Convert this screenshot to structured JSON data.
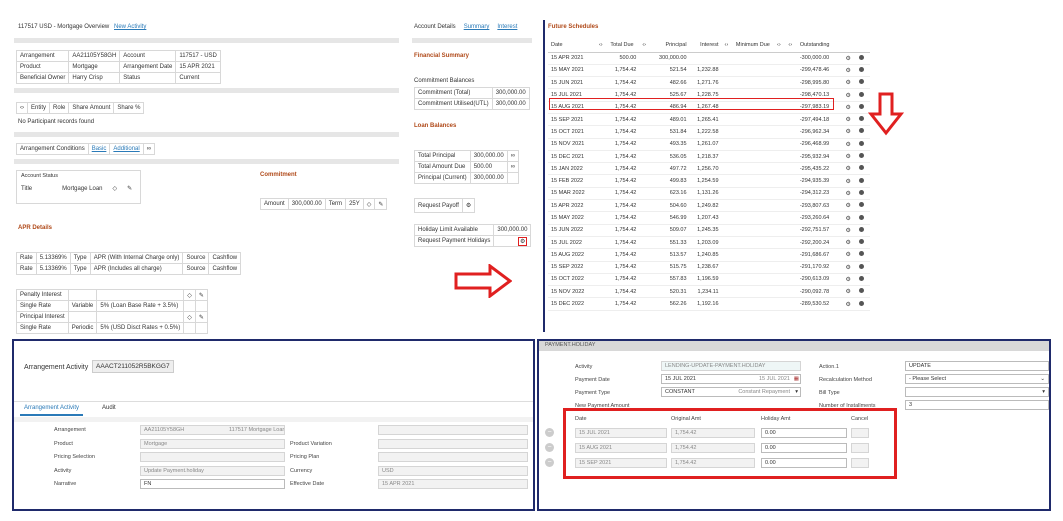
{
  "p1": {
    "title": "117517 USD - Mortgage Overview",
    "new_activity": "New Activity",
    "tabs": [
      "Account Details",
      "Summary",
      "Interest"
    ],
    "arr": [
      [
        "Arrangement",
        "AA21105Y58GH",
        "Account",
        "117517 - USD"
      ],
      [
        "Product",
        "Mortgage",
        "Arrangement Date",
        "15 APR 2021"
      ],
      [
        "Beneficial Owner",
        "Harry Crisp",
        "Status",
        "Current"
      ]
    ],
    "part_headers": [
      "Entity",
      "Role",
      "Share Amount",
      "Share %"
    ],
    "part_empty": "No Participant records found",
    "cond_label": "Arrangement Conditions",
    "cond_basic": "Basic",
    "cond_additional": "Additional",
    "acct_status": "Account Status",
    "title_lbl": "Title",
    "title_val": "Mortgage Loan",
    "commitment": "Commitment",
    "commit_row": [
      "Amount",
      "300,000.00",
      "Term",
      "25Y"
    ],
    "apr_title": "APR Details",
    "apr": [
      [
        "Rate",
        "5.13369%",
        "Type",
        "APR (With Internal Charge only)",
        "Source",
        "Cashflow"
      ],
      [
        "Rate",
        "5.13369%",
        "Type",
        "APR (Includes all charge)",
        "Source",
        "Cashflow"
      ]
    ],
    "pen": [
      [
        "Penalty Interest",
        "",
        ""
      ],
      [
        "Single Rate",
        "Variable",
        "5% (Loan Base Rate + 3.5%)"
      ],
      [
        "Principal Interest",
        "",
        ""
      ],
      [
        "Single Rate",
        "Periodic",
        "5% (USD Disct Rates + 0.5%)"
      ]
    ],
    "fin_summary": "Financial Summary",
    "commit_bal": "Commitment Balances",
    "cb": [
      [
        "Commitment (Total)",
        "300,000.00"
      ],
      [
        "Commitment Utilised(UTL)",
        "300,000.00"
      ]
    ],
    "loan_bal": "Loan Balances",
    "lb": [
      [
        "Total Principal",
        "300,000.00"
      ],
      [
        "Total Amount Due",
        "500.00"
      ],
      [
        "Principal (Current)",
        "300,000.00"
      ]
    ],
    "req_payoff": "Request Payoff",
    "hol_limit": "Holiday Limit Available",
    "hol_limit_val": "300,000.00",
    "req_hol": "Request Payment Holidays"
  },
  "fs": {
    "title": "Future Schedules",
    "headers": [
      "Date",
      "Total Due",
      "Principal",
      "Interest",
      "Minimum Due",
      "Outstanding"
    ],
    "rows": [
      [
        "15 APR 2021",
        "500.00",
        "300,000.00",
        "",
        "-300,000.00"
      ],
      [
        "15 MAY 2021",
        "1,754.42",
        "521.54",
        "1,232.88",
        "-299,478.46"
      ],
      [
        "15 JUN 2021",
        "1,754.42",
        "482.66",
        "1,271.76",
        "-298,995.80"
      ],
      [
        "15 JUL 2021",
        "1,754.42",
        "525.67",
        "1,228.75",
        "-298,470.13"
      ],
      [
        "15 AUG 2021",
        "1,754.42",
        "486.94",
        "1,267.48",
        "-297,983.19"
      ],
      [
        "15 SEP 2021",
        "1,754.42",
        "489.01",
        "1,265.41",
        "-297,494.18"
      ],
      [
        "15 OCT 2021",
        "1,754.42",
        "531.84",
        "1,222.58",
        "-296,962.34"
      ],
      [
        "15 NOV 2021",
        "1,754.42",
        "493.35",
        "1,261.07",
        "-296,468.99"
      ],
      [
        "15 DEC 2021",
        "1,754.42",
        "536.05",
        "1,218.37",
        "-295,932.94"
      ],
      [
        "15 JAN 2022",
        "1,754.42",
        "497.72",
        "1,256.70",
        "-295,435.22"
      ],
      [
        "15 FEB 2022",
        "1,754.42",
        "499.83",
        "1,254.59",
        "-294,935.39"
      ],
      [
        "15 MAR 2022",
        "1,754.42",
        "623.16",
        "1,131.26",
        "-294,312.23"
      ],
      [
        "15 APR 2022",
        "1,754.42",
        "504.60",
        "1,249.82",
        "-293,807.63"
      ],
      [
        "15 MAY 2022",
        "1,754.42",
        "546.99",
        "1,207.43",
        "-293,260.64"
      ],
      [
        "15 JUN 2022",
        "1,754.42",
        "509.07",
        "1,245.35",
        "-292,751.57"
      ],
      [
        "15 JUL 2022",
        "1,754.42",
        "551.33",
        "1,203.09",
        "-292,200.24"
      ],
      [
        "15 AUG 2022",
        "1,754.42",
        "513.57",
        "1,240.85",
        "-291,686.67"
      ],
      [
        "15 SEP 2022",
        "1,754.42",
        "515.75",
        "1,238.67",
        "-291,170.92"
      ],
      [
        "15 OCT 2022",
        "1,754.42",
        "557.83",
        "1,196.59",
        "-290,613.09"
      ],
      [
        "15 NOV 2022",
        "1,754.42",
        "520.31",
        "1,234.11",
        "-290,092.78"
      ],
      [
        "15 DEC 2022",
        "1,754.42",
        "562.26",
        "1,192.16",
        "-289,530.52"
      ]
    ]
  },
  "p3": {
    "label": "Arrangement Activity",
    "act_id": "AAACT211052R5BKGG7",
    "tabs": [
      "Arrangement Activity",
      "Audit"
    ],
    "fields": [
      [
        "Arrangement",
        "AA21105Y58GH",
        "117517 Mortgage Loan",
        "",
        ""
      ],
      [
        "Product",
        "Mortgage",
        "",
        "Product Variation",
        ""
      ],
      [
        "Pricing Selection",
        "",
        "",
        "Pricing Plan",
        ""
      ],
      [
        "Activity",
        "Update Payment.holiday",
        "",
        "Currency",
        "USD"
      ],
      [
        "Narrative",
        "FN",
        "",
        "Effective Date",
        "15 APR 2021"
      ]
    ]
  },
  "p4": {
    "header": "PAYMENT.HOLIDAY",
    "activity_lbl": "Activity",
    "activity_val": "LENDING-UPDATE-PAYMENT.HOLIDAY",
    "action_lbl": "Action.1",
    "action_val": "UPDATE",
    "paydate_lbl": "Payment Date",
    "paydate_val": "15 JUL 2021",
    "paydate_val2": "15 JUL 2021",
    "recalc_lbl": "Recalculation Method",
    "recalc_val": "- Please Select",
    "paytype_lbl": "Payment Type",
    "paytype_val": "CONSTANT",
    "paytype_val2": "Constant Repayment",
    "billtype_lbl": "Bill Type",
    "newpay_lbl": "New Payment Amount",
    "ninst_lbl": "Number of Installments",
    "ninst_val": "3",
    "hol_headers": [
      "Date",
      "Original Amt",
      "Holiday Amt",
      "Cancel"
    ],
    "hol_rows": [
      [
        "15 JUL 2021",
        "1,754.42",
        "0.00"
      ],
      [
        "15 AUG 2021",
        "1,754.42",
        "0.00"
      ],
      [
        "15 SEP 2021",
        "1,754.42",
        "0.00"
      ]
    ]
  },
  "colors": {
    "red": "#e02020",
    "navy": "#1f2a6b",
    "orange": "#b04a1a",
    "link": "#2a7ab8"
  }
}
